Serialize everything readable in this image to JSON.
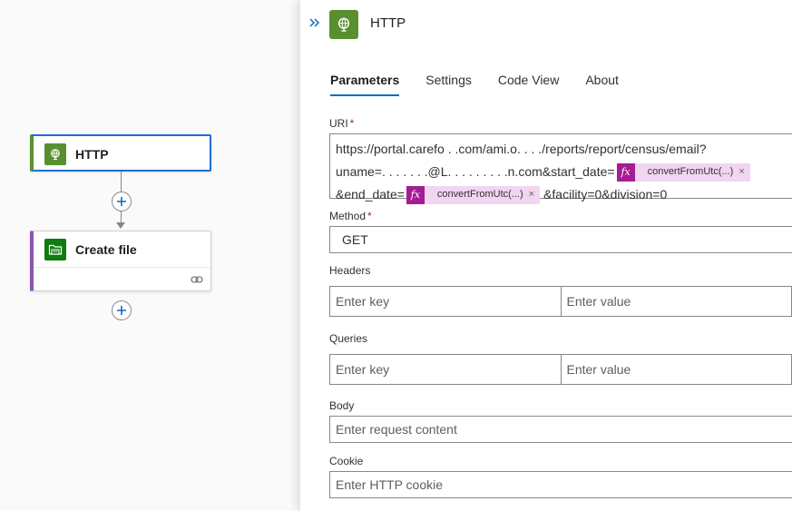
{
  "canvas": {
    "http_node": {
      "title": "HTTP"
    },
    "file_node": {
      "title": "Create file"
    }
  },
  "panel": {
    "title": "HTTP",
    "tabs": [
      {
        "label": "Parameters"
      },
      {
        "label": "Settings"
      },
      {
        "label": "Code View"
      },
      {
        "label": "About"
      }
    ],
    "uri": {
      "label": "URI",
      "required_mark": "*",
      "line1": "https://portal.carefo . .com/ami.o. . . ./reports/report/census/email?",
      "line2_prefix": "uname=. . . . . . .@L. . . . . . . . .n.com&start_date=",
      "line3_prefix": "&end_date=",
      "line3_suffix": "&facility=0&division=0",
      "tokens": [
        {
          "icon": "fx",
          "label": "convertFromUtc(...)",
          "remove": "×"
        },
        {
          "icon": "fx",
          "label": "convertFromUtc(...)",
          "remove": "×"
        }
      ]
    },
    "method": {
      "label": "Method",
      "required_mark": "*",
      "value": "GET"
    },
    "headers": {
      "label": "Headers",
      "key_placeholder": "Enter key",
      "value_placeholder": "Enter value"
    },
    "queries": {
      "label": "Queries",
      "key_placeholder": "Enter key",
      "value_placeholder": "Enter value"
    },
    "body": {
      "label": "Body",
      "placeholder": "Enter request content"
    },
    "cookie": {
      "label": "Cookie",
      "placeholder": "Enter HTTP cookie"
    }
  },
  "colors": {
    "http_green": "#5a8f2f",
    "file_green": "#107c10",
    "selected_blue": "#1f6fd6",
    "token_pink": "#a51d92"
  },
  "icons": [
    "globe-icon",
    "folder-icon",
    "link-icon",
    "add-icon",
    "collapse-chevron-icon",
    "fx-icon",
    "remove-icon"
  ]
}
